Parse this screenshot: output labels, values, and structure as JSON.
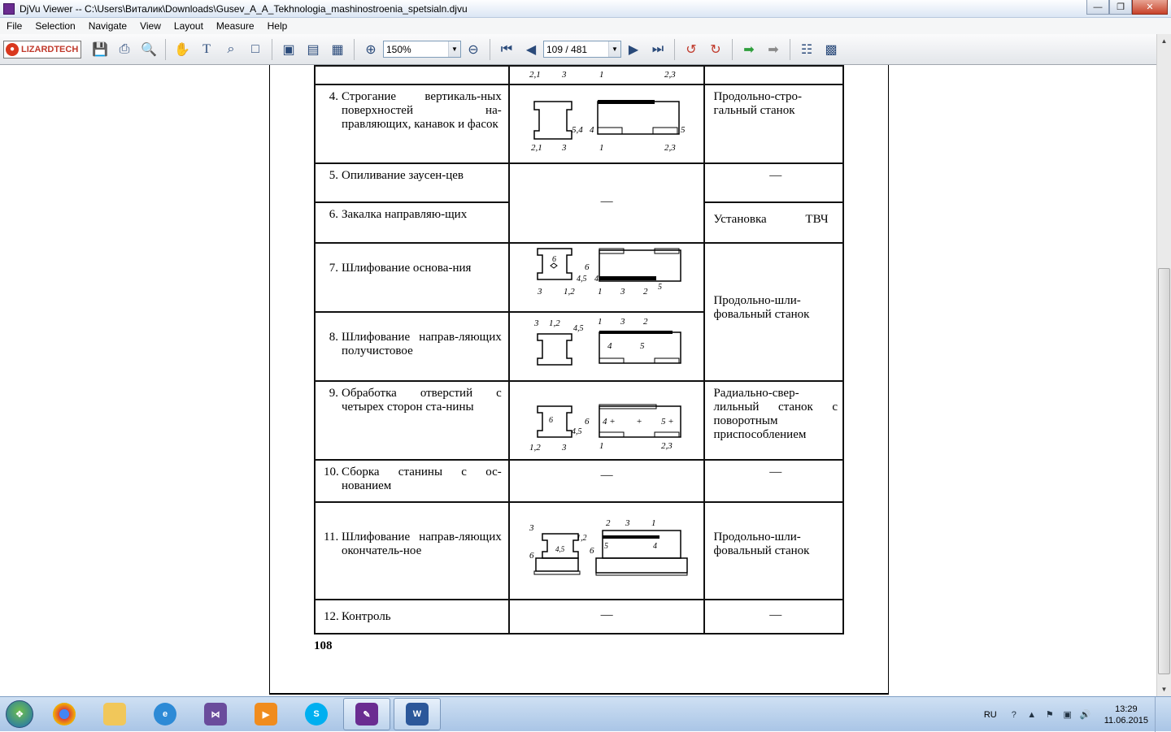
{
  "window": {
    "title": "DjVu Viewer -- C:\\Users\\Виталик\\Downloads\\Gusev_A_A_Tekhnologia_mashinostroenia_spetsialn.djvu"
  },
  "menu": [
    "File",
    "Selection",
    "Navigate",
    "View",
    "Layout",
    "Measure",
    "Help"
  ],
  "toolbar": {
    "logo_text": "LIZARDTECH",
    "zoom_value": "150%",
    "page_value": "109 / 481",
    "icons": [
      "save-icon",
      "print-icon",
      "find-icon",
      "hand-icon",
      "text-select-icon",
      "zoom-select-icon",
      "region-select-icon",
      "single-page-icon",
      "continuous-icon",
      "facing-icon",
      "zoom-in-icon",
      "zoom-out-icon",
      "first-page-icon",
      "prev-page-icon",
      "next-page-icon",
      "last-page-icon",
      "rotate-left-icon",
      "rotate-right-icon",
      "back-icon",
      "forward-icon",
      "thumbnail-icon",
      "document-icon"
    ]
  },
  "document": {
    "rows": [
      {
        "num": "4.",
        "text": "Строгание вертикаль-ных поверхностей на-правляющих, канавок и фасок",
        "equipment": "Продольно-стро-гальный станок",
        "sketch_labels": [
          "2,1",
          "3",
          "5,4",
          "4",
          "1",
          "5",
          "2,3"
        ]
      },
      {
        "num": "5.",
        "text": "Опиливание заусен-цев",
        "equipment": "—",
        "sketch_labels": []
      },
      {
        "num": "6.",
        "text": "Закалка направляю-щих",
        "equipment": "Установка ТВЧ",
        "sketch_labels": []
      },
      {
        "num": "7.",
        "text": "Шлифование основа-ния",
        "equipment": "",
        "sketch_labels": [
          "6",
          "6",
          "4,5",
          "4",
          "3",
          "1,2",
          "1",
          "3",
          "2",
          "5"
        ]
      },
      {
        "num": "8.",
        "text": "Шлифование направ-ляющих получистовое",
        "equipment": "Продольно-шли-фовальный станок",
        "sketch_labels": [
          "3",
          "1,2",
          "4,5",
          "1",
          "3",
          "2",
          "4",
          "5"
        ]
      },
      {
        "num": "9.",
        "text": "Обработка отверстий с четырех сторон ста-нины",
        "equipment": "Радиально-свер-лильный станок с поворотным приспособлением",
        "sketch_labels": [
          "6",
          "4,5",
          "1,2",
          "3",
          "6",
          "4",
          "5",
          "1",
          "2,3"
        ]
      },
      {
        "num": "10.",
        "text": "Сборка станины с ос-нованием",
        "equipment": "—",
        "sketch_labels": []
      },
      {
        "num": "11.",
        "text": "Шлифование направ-ляющих окончатель-ное",
        "equipment": "Продольно-шли-фовальный станок",
        "sketch_labels": [
          "3",
          "1,2",
          "4,5",
          "6",
          "2",
          "3",
          "1",
          "5",
          "4",
          "6"
        ]
      },
      {
        "num": "12.",
        "text": "Контроль",
        "equipment": "—",
        "sketch_labels": []
      }
    ],
    "dash": "—",
    "page_number": "108"
  },
  "taskbar": {
    "apps": [
      "Chrome",
      "Windows Explorer",
      "Internet Explorer",
      "Visual Studio",
      "Media Player",
      "Skype",
      "DjVu Viewer",
      "Microsoft Word"
    ],
    "lang": "RU",
    "time": "13:29",
    "date": "11.06.2015"
  }
}
